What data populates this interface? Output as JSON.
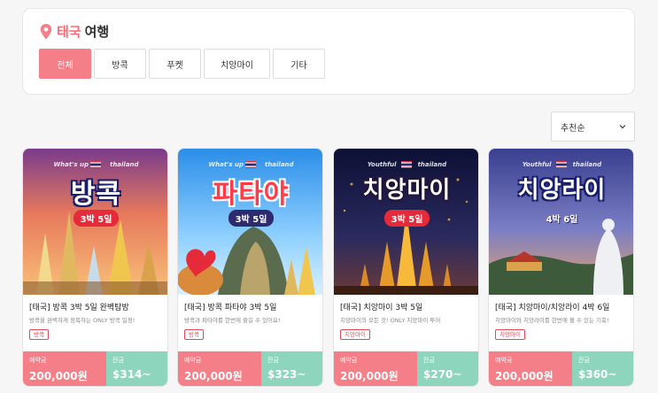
{
  "header": {
    "country": "태국",
    "title_suffix": "여행"
  },
  "tabs": [
    {
      "label": "전체",
      "active": true
    },
    {
      "label": "방콕",
      "active": false
    },
    {
      "label": "푸켓",
      "active": false
    },
    {
      "label": "치앙마이",
      "active": false
    },
    {
      "label": "기타",
      "active": false
    }
  ],
  "sort": {
    "selected": "추천순"
  },
  "products": [
    {
      "thumb_title": "방콕",
      "thumb_badge": "3박 5일",
      "thumb_tagline_left": "What's up",
      "thumb_tagline_right": "thailand",
      "name": "[태국] 방콕 3박 5일 완벽탐방",
      "desc": "방콕을 완벽하게 정복하는 ONLY 방콕 일정!",
      "tag": "방콕",
      "deposit_label": "예약금",
      "deposit": "200,000원",
      "balance_label": "잔금",
      "balance": "$314~"
    },
    {
      "thumb_title": "파타야",
      "thumb_badge": "3박 5일",
      "thumb_tagline_left": "What's up",
      "thumb_tagline_right": "thailand",
      "name": "[태국] 방콕 파타야 3박 5일",
      "desc": "방콕과 파타야를 한번에 즐길 수 있어요!",
      "tag": "방콕",
      "deposit_label": "예약금",
      "deposit": "200,000원",
      "balance_label": "잔금",
      "balance": "$323~"
    },
    {
      "thumb_title": "치앙마이",
      "thumb_badge": "3박 5일",
      "thumb_tagline_left": "Youthful",
      "thumb_tagline_right": "thailand",
      "name": "[태국] 치앙마이 3박 5일",
      "desc": "치앙마이의 모든 것! ONLY 치앙마이 투어",
      "tag": "치앙마이",
      "deposit_label": "예약금",
      "deposit": "200,000원",
      "balance_label": "잔금",
      "balance": "$270~"
    },
    {
      "thumb_title": "치앙라이",
      "thumb_badge": "4박 6일",
      "thumb_tagline_left": "Youthful",
      "thumb_tagline_right": "thailand",
      "name": "[태국] 치앙마이/치앙라이 4박 6일",
      "desc": "치앙마이와 치앙라이를 한번에 볼 수 있는 기회!",
      "tag": "치앙마이",
      "deposit_label": "예약금",
      "deposit": "200,000원",
      "balance_label": "잔금",
      "balance": "$360~"
    }
  ],
  "colors": {
    "accent": "#f47f88",
    "mint": "#8dd6bd",
    "tag_red": "#e5485a"
  },
  "icons": {
    "location": "map-pin-icon",
    "sort": "chevron-down-icon"
  }
}
